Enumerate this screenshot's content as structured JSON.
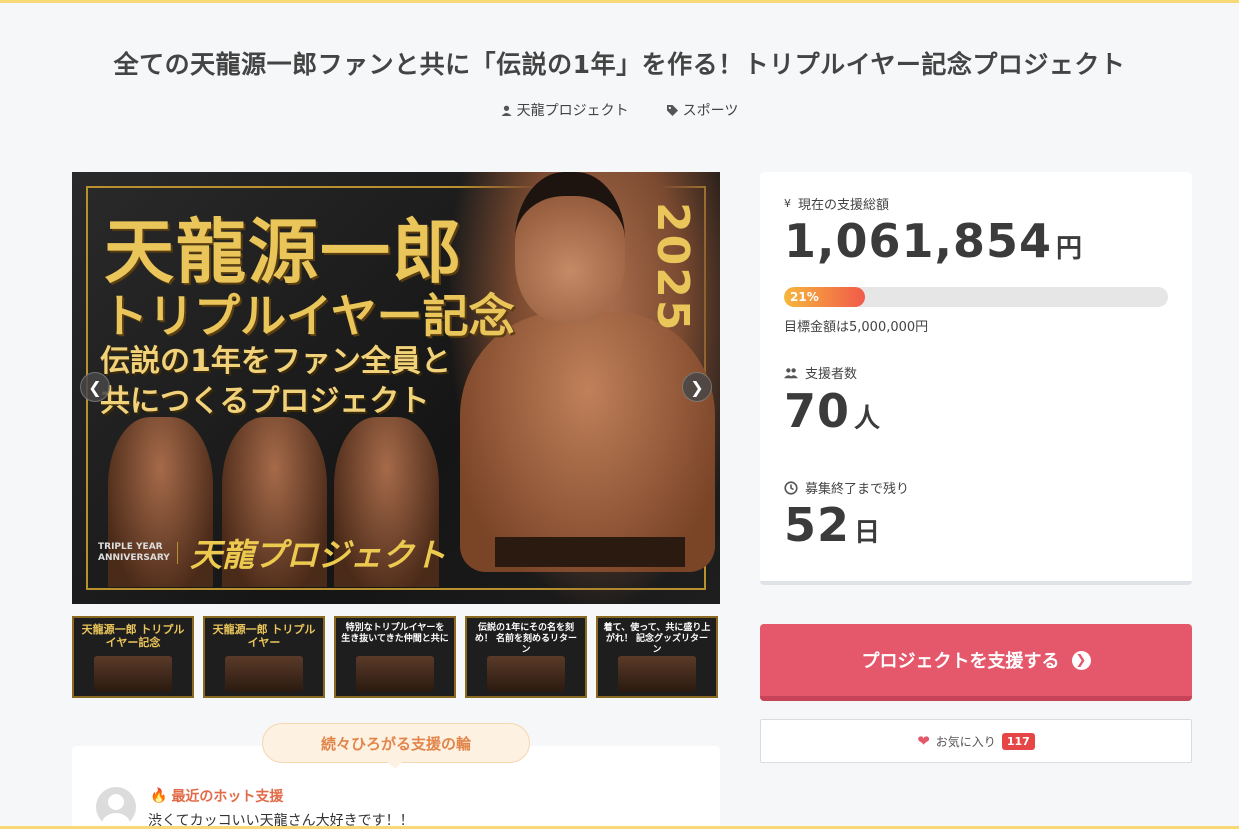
{
  "header": {
    "title": "全ての天龍源一郎ファンと共に「伝説の1年」を作る！トリプルイヤー記念プロジェクト",
    "owner": "天龍プロジェクト",
    "category": "スポーツ"
  },
  "hero": {
    "line1": "天龍源一郎",
    "line2": "トリプルイヤー記念",
    "line3a": "伝説の1年をファン全員と",
    "line3b": "共につくるプロジェクト",
    "year": "2025",
    "anniversary": "TRIPLE YEAR ANNIVERSARY",
    "brand": "天龍プロジェクト",
    "prev_icon": "chevron-left-icon",
    "next_icon": "chevron-right-icon"
  },
  "thumbnails": [
    {
      "caption": "天龍源一郎 トリプルイヤー記念"
    },
    {
      "caption": "天龍源一郎 トリプルイヤー"
    },
    {
      "caption": "特別なトリプルイヤーを 生き抜いてきた仲間と共に"
    },
    {
      "caption": "伝説の1年にその名を刻め！ 名前を刻めるリターン"
    },
    {
      "caption": "着て、使って、共に盛り上がれ！ 記念グッズリターン"
    }
  ],
  "support_ring": {
    "badge": "続々ひろがる支援の輪",
    "hot_label": "最近のホット支援",
    "message": "渋くてカッコいい天龍さん大好きです！！"
  },
  "stats": {
    "total_label": "現在の支援総額",
    "total_value": "1,061,854",
    "total_unit": "円",
    "progress_percent": 21,
    "progress_text": "21%",
    "goal_text": "目標金額は5,000,000円",
    "supporters_label": "支援者数",
    "supporters_value": "70",
    "supporters_unit": "人",
    "remaining_label": "募集終了まで残り",
    "remaining_value": "52",
    "remaining_unit": "日"
  },
  "actions": {
    "support_button": "プロジェクトを支援する",
    "favorite_label": "お気に入り",
    "favorite_count": "117"
  },
  "colors": {
    "accent": "#e5576a",
    "gold": "#e9c55a",
    "top_border": "#f7d978"
  }
}
